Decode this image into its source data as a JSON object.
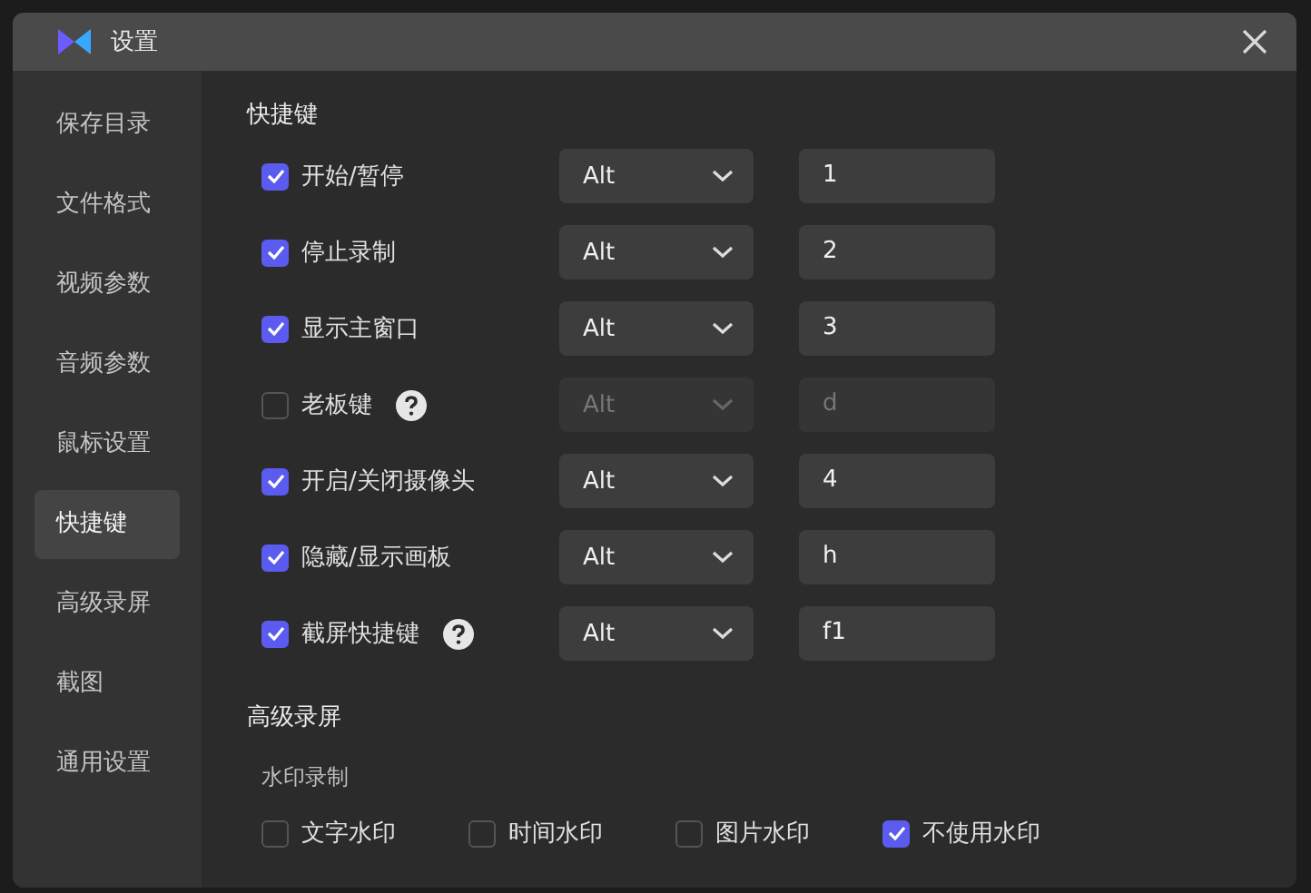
{
  "window": {
    "title": "设置"
  },
  "sidebar": {
    "items": [
      {
        "label": "保存目录",
        "selected": false
      },
      {
        "label": "文件格式",
        "selected": false
      },
      {
        "label": "视频参数",
        "selected": false
      },
      {
        "label": "音频参数",
        "selected": false
      },
      {
        "label": "鼠标设置",
        "selected": false
      },
      {
        "label": "快捷键",
        "selected": true
      },
      {
        "label": "高级录屏",
        "selected": false
      },
      {
        "label": "截图",
        "selected": false
      },
      {
        "label": "通用设置",
        "selected": false
      }
    ]
  },
  "shortcuts": {
    "title": "快捷键",
    "rows": [
      {
        "label": "开始/暂停",
        "checked": true,
        "help": false,
        "modifier": "Alt",
        "key": "1",
        "disabled": false
      },
      {
        "label": "停止录制",
        "checked": true,
        "help": false,
        "modifier": "Alt",
        "key": "2",
        "disabled": false
      },
      {
        "label": "显示主窗口",
        "checked": true,
        "help": false,
        "modifier": "Alt",
        "key": "3",
        "disabled": false
      },
      {
        "label": "老板键",
        "checked": false,
        "help": true,
        "modifier": "Alt",
        "key": "d",
        "disabled": true
      },
      {
        "label": "开启/关闭摄像头",
        "checked": true,
        "help": false,
        "modifier": "Alt",
        "key": "4",
        "disabled": false
      },
      {
        "label": "隐藏/显示画板",
        "checked": true,
        "help": false,
        "modifier": "Alt",
        "key": "h",
        "disabled": false
      },
      {
        "label": "截屏快捷键",
        "checked": true,
        "help": true,
        "modifier": "Alt",
        "key": "f1",
        "disabled": false
      }
    ]
  },
  "advanced": {
    "title": "高级录屏",
    "subtitle": "水印录制",
    "options": [
      {
        "label": "文字水印",
        "checked": false
      },
      {
        "label": "时间水印",
        "checked": false
      },
      {
        "label": "图片水印",
        "checked": false
      },
      {
        "label": "不使用水印",
        "checked": true
      }
    ]
  }
}
